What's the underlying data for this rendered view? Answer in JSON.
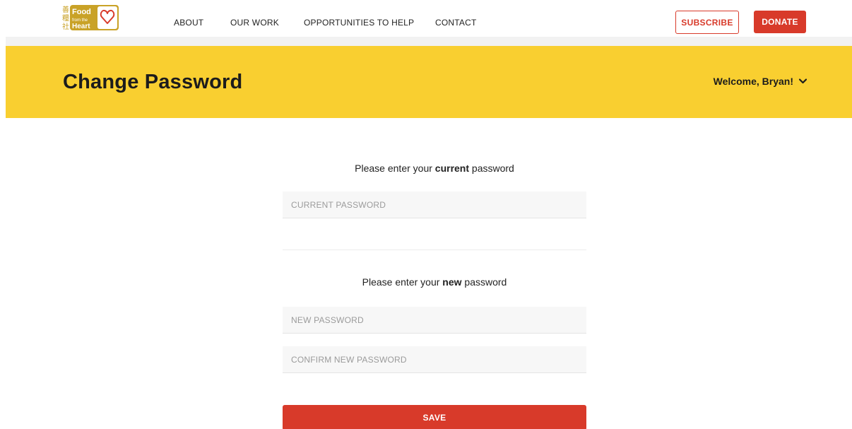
{
  "header": {
    "logo": {
      "chinese_text": "善糧社",
      "line1": "Food",
      "line2": "from the",
      "line3": "Heart",
      "brand_color": "#c9a227"
    },
    "nav": [
      {
        "label": "ABOUT"
      },
      {
        "label": "OUR WORK"
      },
      {
        "label": "OPPORTUNITIES TO HELP"
      },
      {
        "label": "CONTACT"
      }
    ],
    "subscribe_label": "SUBSCRIBE",
    "donate_label": "DONATE"
  },
  "banner": {
    "title": "Change Password",
    "welcome": "Welcome, Bryan!",
    "background": "#f9cf30"
  },
  "form": {
    "current_prompt": {
      "before": "Please enter your ",
      "bold": "current",
      "after": " password"
    },
    "current_placeholder": "CURRENT PASSWORD",
    "new_prompt": {
      "before": "Please enter your ",
      "bold": "new",
      "after": " password"
    },
    "new_placeholder": "NEW PASSWORD",
    "confirm_placeholder": "CONFIRM NEW PASSWORD",
    "save_label": "SAVE"
  },
  "colors": {
    "accent": "#d83a2a",
    "banner": "#f9cf30"
  },
  "icons": {
    "welcome_dropdown": "chevron-down-icon",
    "logo_heart": "heart-icon"
  }
}
